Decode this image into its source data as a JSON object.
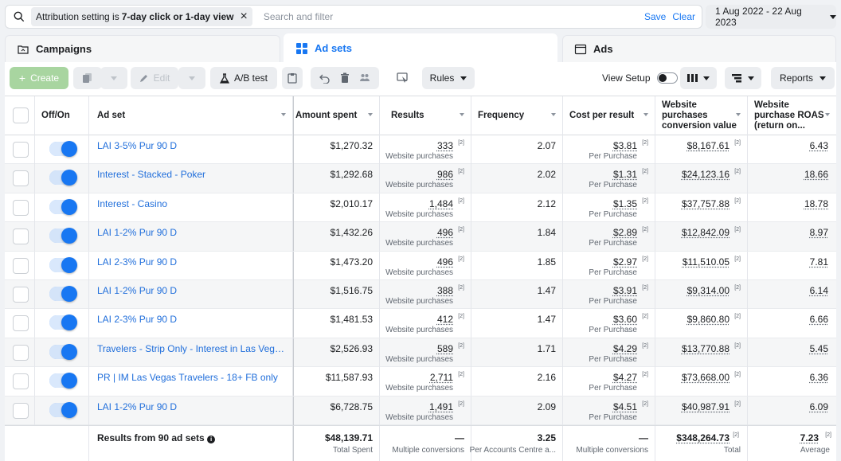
{
  "filter": {
    "chip_prefix": "Attribution setting is",
    "chip_value": "7-day click or 1-day view",
    "placeholder": "Search and filter",
    "save": "Save",
    "clear": "Clear"
  },
  "date_range": "1 Aug 2022 - 22 Aug 2023",
  "tabs": [
    {
      "label": "Campaigns",
      "active": false
    },
    {
      "label": "Ad sets",
      "active": true
    },
    {
      "label": "Ads",
      "active": false
    }
  ],
  "toolbar": {
    "create": "Create",
    "edit": "Edit",
    "ab_test": "A/B test",
    "rules": "Rules",
    "view_setup": "View Setup",
    "reports": "Reports"
  },
  "columns": {
    "off_on": "Off/On",
    "ad_set": "Ad set",
    "amount_spent": "Amount spent",
    "results": "Results",
    "frequency": "Frequency",
    "cost_per_result": "Cost per result",
    "conv_value_l1": "Website",
    "conv_value_l2": "purchases",
    "conv_value_l3": "conversion value",
    "roas_l1": "Website",
    "roas_l2": "purchase ROAS",
    "roas_l3": "(return on..."
  },
  "rows": [
    {
      "name": "LAI 3-5% Pur 90 D",
      "spent": "$1,270.32",
      "results": "333",
      "results_sub": "Website purchases",
      "frequency": "2.07",
      "cpr": "$3.81",
      "cpr_sub": "Per Purchase",
      "value": "$8,167.61",
      "roas": "6.43"
    },
    {
      "name": "Interest - Stacked - Poker",
      "spent": "$1,292.68",
      "results": "986",
      "results_sub": "Website purchases",
      "frequency": "2.02",
      "cpr": "$1.31",
      "cpr_sub": "Per Purchase",
      "value": "$24,123.16",
      "roas": "18.66"
    },
    {
      "name": "Interest - Casino",
      "spent": "$2,010.17",
      "results": "1,484",
      "results_sub": "Website purchases",
      "frequency": "2.12",
      "cpr": "$1.35",
      "cpr_sub": "Per Purchase",
      "value": "$37,757.88",
      "roas": "18.78"
    },
    {
      "name": "LAI 1-2% Pur 90 D",
      "spent": "$1,432.26",
      "results": "496",
      "results_sub": "Website purchases",
      "frequency": "1.84",
      "cpr": "$2.89",
      "cpr_sub": "Per Purchase",
      "value": "$12,842.09",
      "roas": "8.97"
    },
    {
      "name": "LAI 2-3% Pur 90 D",
      "spent": "$1,473.20",
      "results": "496",
      "results_sub": "Website purchases",
      "frequency": "1.85",
      "cpr": "$2.97",
      "cpr_sub": "Per Purchase",
      "value": "$11,510.05",
      "roas": "7.81"
    },
    {
      "name": "LAI 1-2% Pur 90 D",
      "spent": "$1,516.75",
      "results": "388",
      "results_sub": "Website purchases",
      "frequency": "1.47",
      "cpr": "$3.91",
      "cpr_sub": "Per Purchase",
      "value": "$9,314.00",
      "roas": "6.14"
    },
    {
      "name": "LAI 2-3% Pur 90 D",
      "spent": "$1,481.53",
      "results": "412",
      "results_sub": "Website purchases",
      "frequency": "1.47",
      "cpr": "$3.60",
      "cpr_sub": "Per Purchase",
      "value": "$9,860.80",
      "roas": "6.66"
    },
    {
      "name": "Travelers - Strip Only - Interest in Las Vegas H...",
      "spent": "$2,526.93",
      "results": "589",
      "results_sub": "Website purchases",
      "frequency": "1.71",
      "cpr": "$4.29",
      "cpr_sub": "Per Purchase",
      "value": "$13,770.88",
      "roas": "5.45"
    },
    {
      "name": "PR | IM Las Vegas Travelers - 18+ FB only",
      "spent": "$11,587.93",
      "results": "2,711",
      "results_sub": "Website purchases",
      "frequency": "2.16",
      "cpr": "$4.27",
      "cpr_sub": "Per Purchase",
      "value": "$73,668.00",
      "roas": "6.36"
    },
    {
      "name": "LAI 1-2% Pur 90 D",
      "spent": "$6,728.75",
      "results": "1,491",
      "results_sub": "Website purchases",
      "frequency": "2.09",
      "cpr": "$4.51",
      "cpr_sub": "Per Purchase",
      "value": "$40,987.91",
      "roas": "6.09"
    }
  ],
  "footnote_marker": "[2]",
  "totals": {
    "label": "Results from 90 ad sets",
    "spent": "$48,139.71",
    "spent_sub": "Total Spent",
    "results": "—",
    "results_sub": "Multiple conversions",
    "frequency": "3.25",
    "frequency_sub": "Per Accounts Centre a...",
    "cpr": "—",
    "cpr_sub": "Multiple conversions",
    "value": "$348,264.73",
    "value_sub": "Total",
    "roas": "7.23",
    "roas_sub": "Average"
  },
  "colors": {
    "accent": "#1877f2",
    "link": "#216fdb",
    "create_green": "#a8d5a0"
  }
}
